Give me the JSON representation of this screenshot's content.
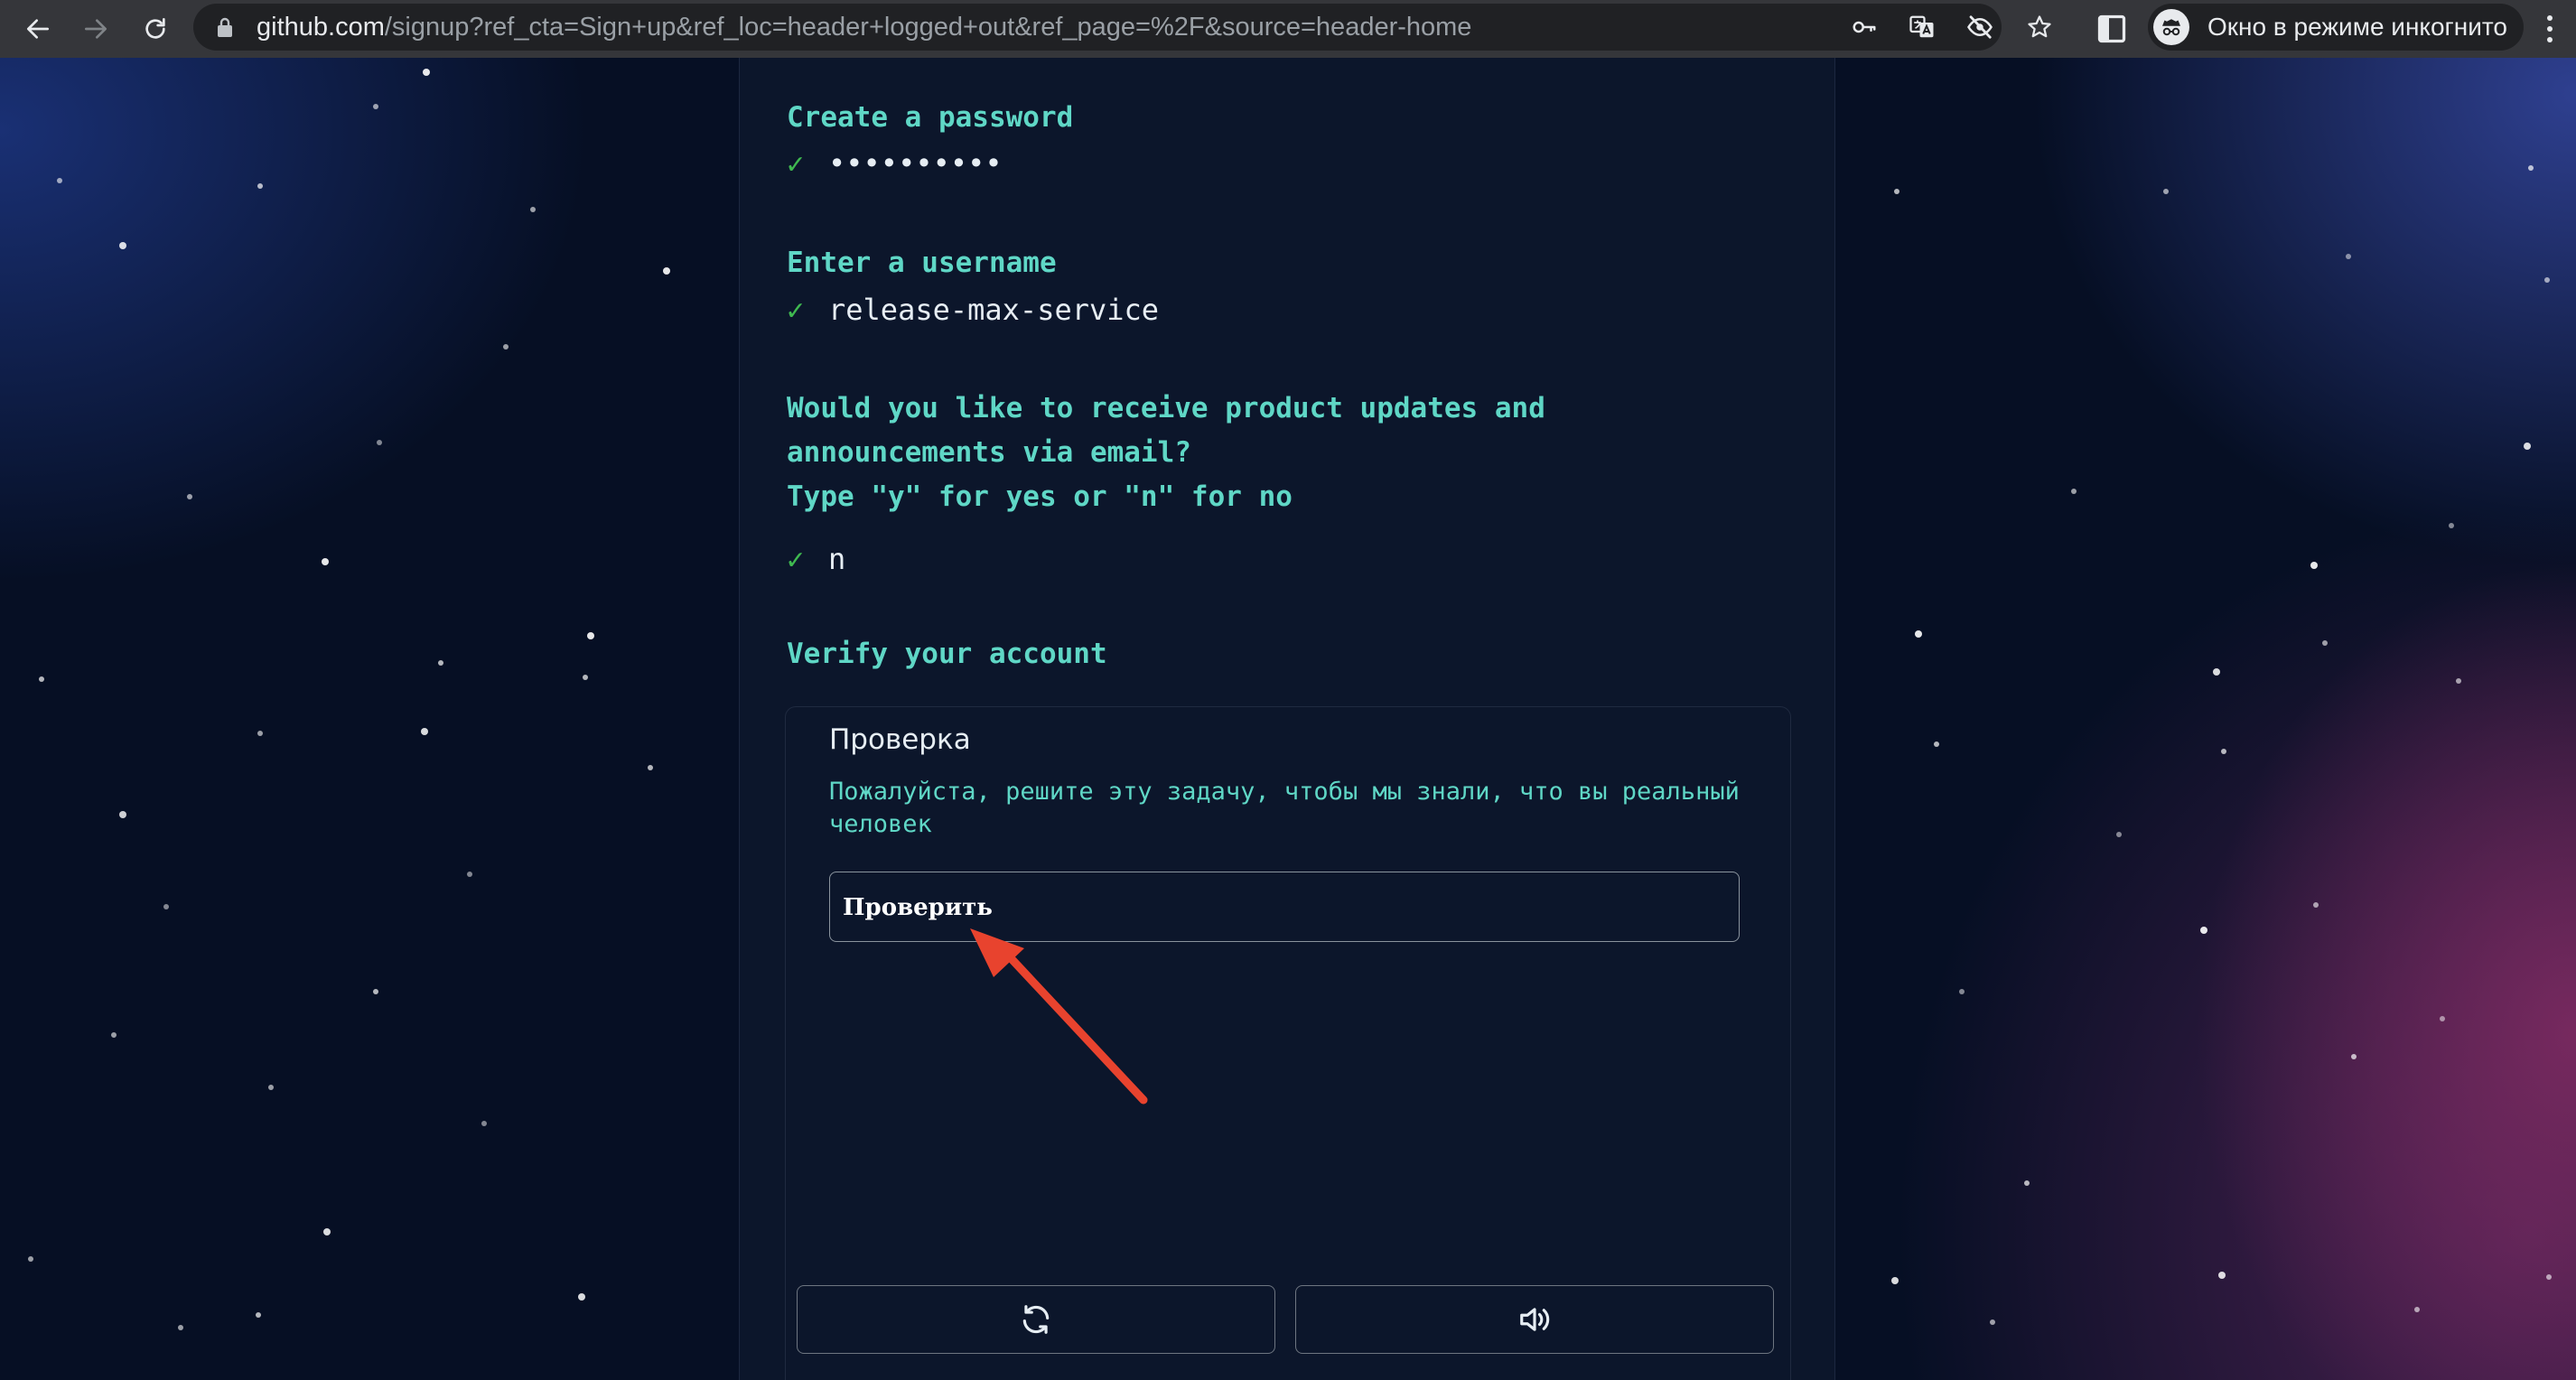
{
  "browser": {
    "url_host": "github.com",
    "url_path": "/signup?ref_cta=Sign+up&ref_loc=header+logged+out&ref_page=%2F&source=header-home",
    "incognito_label": "Окно в режиме инкогнито"
  },
  "signup": {
    "password_prompt": "Create a password",
    "password_value": "••••••••••",
    "username_prompt": "Enter a username",
    "username_value": "release-max-service",
    "email_prompt_line1": "Would you like to receive product updates and",
    "email_prompt_line2": "announcements via email?",
    "email_prompt_line3": "Type \"y\" for yes or \"n\" for no",
    "email_value": "n",
    "verify_prompt": "Verify your account",
    "check_mark": "✓"
  },
  "captcha": {
    "title": "Проверка",
    "description": "Пожалуйста, решите эту задачу, чтобы мы знали, что вы реальный человек",
    "verify_button": "Проверить"
  },
  "colors": {
    "prompt": "#5fd7c6",
    "check": "#3fb950",
    "annotation_arrow": "#e8432e"
  }
}
